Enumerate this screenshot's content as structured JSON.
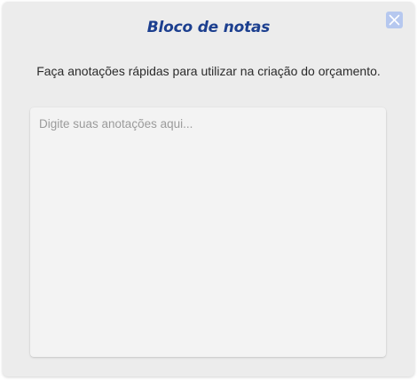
{
  "dialog": {
    "title": "Bloco de notas",
    "subtitle": "Faça anotações rápidas para utilizar na criação do orçamento.",
    "notes": {
      "value": "",
      "placeholder": "Digite suas anotações aqui..."
    },
    "close_icon": "close-icon"
  },
  "colors": {
    "title": "#1c3f8f",
    "close_button_bg": "#b6c8ef",
    "dialog_bg": "#ececec",
    "textarea_bg": "#f3f3f3"
  }
}
